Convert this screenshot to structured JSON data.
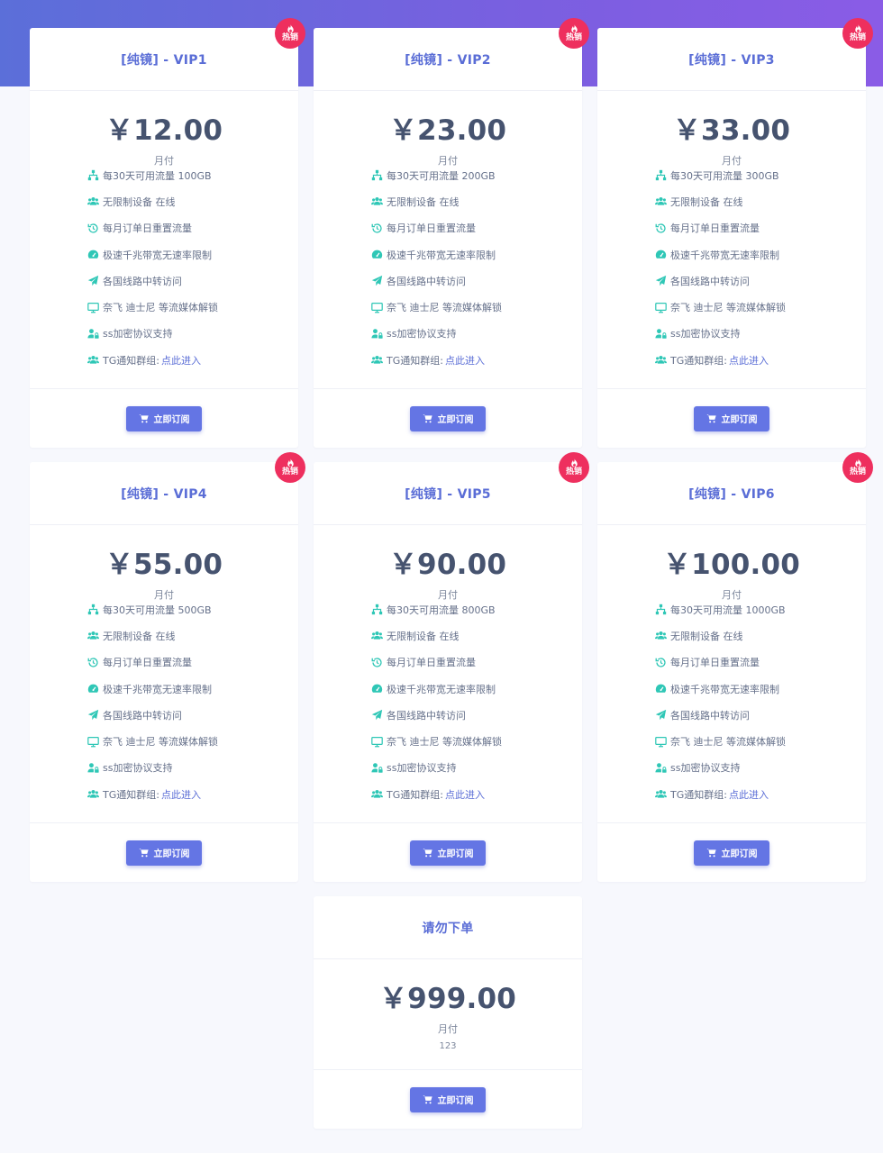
{
  "colors": {
    "accent": "#5a6dd6",
    "icon": "#2fc7b6",
    "hot_badge": "#ee2f5e",
    "button": "#6475e4"
  },
  "badge_label": "热销",
  "button_label": "立即订阅",
  "plans": [
    {
      "title": "[纯镜] - VIP1",
      "price": "￥12.00",
      "period": "月付",
      "hot": true,
      "features": [
        {
          "icon": "network-icon",
          "text": "每30天可用流量 100GB"
        },
        {
          "icon": "users-icon",
          "text": "无限制设备 在线"
        },
        {
          "icon": "history-icon",
          "text": "每月订单日重置流量"
        },
        {
          "icon": "speedometer-icon",
          "text": "极速千兆带宽无速率限制"
        },
        {
          "icon": "paper-plane-icon",
          "text": "各国线路中转访问"
        },
        {
          "icon": "monitor-icon",
          "text": "奈飞 迪士尼 等流媒体解锁"
        },
        {
          "icon": "user-lock-icon",
          "text": "ss加密协议支持"
        },
        {
          "icon": "users-icon",
          "text": "TG通知群组:",
          "link": "点此进入"
        }
      ]
    },
    {
      "title": "[纯镜] - VIP2",
      "price": "￥23.00",
      "period": "月付",
      "hot": true,
      "features": [
        {
          "icon": "network-icon",
          "text": "每30天可用流量 200GB"
        },
        {
          "icon": "users-icon",
          "text": "无限制设备 在线"
        },
        {
          "icon": "history-icon",
          "text": "每月订单日重置流量"
        },
        {
          "icon": "speedometer-icon",
          "text": "极速千兆带宽无速率限制"
        },
        {
          "icon": "paper-plane-icon",
          "text": "各国线路中转访问"
        },
        {
          "icon": "monitor-icon",
          "text": "奈飞 迪士尼 等流媒体解锁"
        },
        {
          "icon": "user-lock-icon",
          "text": "ss加密协议支持"
        },
        {
          "icon": "users-icon",
          "text": "TG通知群组:",
          "link": "点此进入"
        }
      ]
    },
    {
      "title": "[纯镜] - VIP3",
      "price": "￥33.00",
      "period": "月付",
      "hot": true,
      "features": [
        {
          "icon": "network-icon",
          "text": "每30天可用流量 300GB"
        },
        {
          "icon": "users-icon",
          "text": "无限制设备 在线"
        },
        {
          "icon": "history-icon",
          "text": "每月订单日重置流量"
        },
        {
          "icon": "speedometer-icon",
          "text": "极速千兆带宽无速率限制"
        },
        {
          "icon": "paper-plane-icon",
          "text": "各国线路中转访问"
        },
        {
          "icon": "monitor-icon",
          "text": "奈飞 迪士尼 等流媒体解锁"
        },
        {
          "icon": "user-lock-icon",
          "text": "ss加密协议支持"
        },
        {
          "icon": "users-icon",
          "text": "TG通知群组:",
          "link": "点此进入"
        }
      ]
    },
    {
      "title": "[纯镜] - VIP4",
      "price": "￥55.00",
      "period": "月付",
      "hot": true,
      "features": [
        {
          "icon": "network-icon",
          "text": "每30天可用流量 500GB"
        },
        {
          "icon": "users-icon",
          "text": "无限制设备 在线"
        },
        {
          "icon": "history-icon",
          "text": "每月订单日重置流量"
        },
        {
          "icon": "speedometer-icon",
          "text": "极速千兆带宽无速率限制"
        },
        {
          "icon": "paper-plane-icon",
          "text": "各国线路中转访问"
        },
        {
          "icon": "monitor-icon",
          "text": "奈飞 迪士尼 等流媒体解锁"
        },
        {
          "icon": "user-lock-icon",
          "text": "ss加密协议支持"
        },
        {
          "icon": "users-icon",
          "text": "TG通知群组:",
          "link": "点此进入"
        }
      ]
    },
    {
      "title": "[纯镜] - VIP5",
      "price": "￥90.00",
      "period": "月付",
      "hot": true,
      "features": [
        {
          "icon": "network-icon",
          "text": "每30天可用流量 800GB"
        },
        {
          "icon": "users-icon",
          "text": "无限制设备 在线"
        },
        {
          "icon": "history-icon",
          "text": "每月订单日重置流量"
        },
        {
          "icon": "speedometer-icon",
          "text": "极速千兆带宽无速率限制"
        },
        {
          "icon": "paper-plane-icon",
          "text": "各国线路中转访问"
        },
        {
          "icon": "monitor-icon",
          "text": "奈飞 迪士尼 等流媒体解锁"
        },
        {
          "icon": "user-lock-icon",
          "text": "ss加密协议支持"
        },
        {
          "icon": "users-icon",
          "text": "TG通知群组:",
          "link": "点此进入"
        }
      ]
    },
    {
      "title": "[纯镜] - VIP6",
      "price": "￥100.00",
      "period": "月付",
      "hot": true,
      "features": [
        {
          "icon": "network-icon",
          "text": "每30天可用流量 1000GB"
        },
        {
          "icon": "users-icon",
          "text": "无限制设备 在线"
        },
        {
          "icon": "history-icon",
          "text": "每月订单日重置流量"
        },
        {
          "icon": "speedometer-icon",
          "text": "极速千兆带宽无速率限制"
        },
        {
          "icon": "paper-plane-icon",
          "text": "各国线路中转访问"
        },
        {
          "icon": "monitor-icon",
          "text": "奈飞 迪士尼 等流媒体解锁"
        },
        {
          "icon": "user-lock-icon",
          "text": "ss加密协议支持"
        },
        {
          "icon": "users-icon",
          "text": "TG通知群组:",
          "link": "点此进入"
        }
      ]
    }
  ],
  "special_plan": {
    "title": "请勿下单",
    "price": "￥999.00",
    "period": "月付",
    "description": "123"
  }
}
